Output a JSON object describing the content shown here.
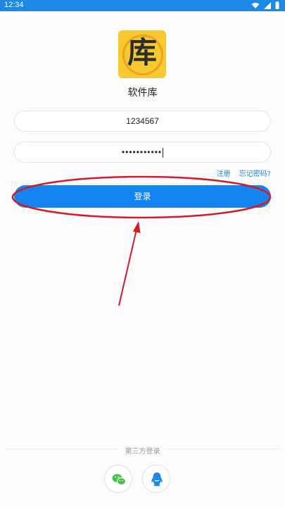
{
  "status_bar": {
    "time": "12:34"
  },
  "logo": {
    "char": "库"
  },
  "app": {
    "name": "软件库"
  },
  "login": {
    "username_value": "1234567",
    "password_value": "•••••••••••",
    "register_label": "注册",
    "forgot_label": "忘记密码?",
    "login_button": "登录"
  },
  "third_party": {
    "title": "第三方登录",
    "providers": [
      "wechat-icon",
      "qq-icon"
    ]
  },
  "colors": {
    "accent": "#1484f0",
    "status_bar": "#1e88e5",
    "annotation": "#d01c2a"
  }
}
